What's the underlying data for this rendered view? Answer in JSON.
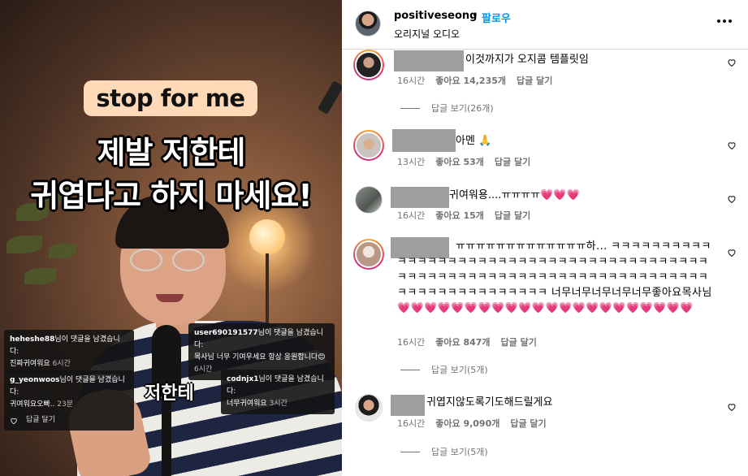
{
  "video": {
    "caption_tag": "stop for me",
    "title_line1": "제발 저한테",
    "title_line2": "귀엽다고 하지 마세요!",
    "sub_caption": "저한테",
    "notifications": [
      {
        "user": "heheshe88",
        "action": "님이 댓글을 남겼습니다:",
        "text": "진짜귀여워요",
        "time": "6시간"
      },
      {
        "user": "user690191577",
        "action": "님이 댓글을 남겼습니다:",
        "text": "목사님 너무 기여우세요 항상 응원합니다😊",
        "time": "6시간"
      },
      {
        "user": "g_yeonwoos",
        "action": "님이 댓글을 남겼습니다:",
        "text": "귀여워요오빠..",
        "time": "23분",
        "reply": "답글 달기"
      },
      {
        "user": "codnjx1",
        "action": "님이 댓글을 남겼습니다:",
        "text": "너무귀여워요",
        "time": "3시간"
      }
    ]
  },
  "header": {
    "username": "positiveseong",
    "separator": "•",
    "follow_label": "팔로우",
    "subtitle": "오리지널 오디오"
  },
  "comments": [
    {
      "text": "이것까지가 오지콤 템플릿임",
      "time": "16시간",
      "likes": "좋아요 14,235개",
      "reply_label": "답글 달기",
      "view_replies": "답글 보기(26개)"
    },
    {
      "text": "아멘 🙏",
      "time": "13시간",
      "likes": "좋아요 53개",
      "reply_label": "답글 달기"
    },
    {
      "text": "귀여워용....ㅠㅠㅠㅠ💗💗💗",
      "time": "16시간",
      "likes": "좋아요 15개",
      "reply_label": "답글 달기"
    },
    {
      "text": "ㅠㅠㅠㅠㅠㅠㅠㅠㅠㅠㅠㅠㅠ하... ㅋㅋㅋㅋㅋㅋㅋㅋㅋㅋㅋㅋㅋㅋㅋㅋㅋㅋㅋㅋㅋㅋㅋㅋㅋㅋㅋㅋㅋㅋㅋㅋㅋㅋㅋㅋㅋㅋㅋㅋㅋㅋㅋㅋㅋㅋㅋㅋㅋㅋㅋㅋㅋㅋㅋㅋㅋㅋㅋㅋㅋㅋㅋㅋㅋㅋㅋㅋㅋㅋㅋㅋㅋㅋㅋㅋㅋㅋㅋㅋㅋㅋㅋㅋㅋㅋㅋ 너무너무너무너무너무좋아요목사님 💗💗💗💗💗💗💗💗💗💗💗💗💗💗💗💗💗💗💗💗💗💗",
      "time": "16시간",
      "likes": "좋아요 847개",
      "reply_label": "답글 달기",
      "view_replies": "답글 보기(5개)"
    },
    {
      "text": "귀엽지않도록기도해드릴게요",
      "time": "16시간",
      "likes": "좋아요 9,090개",
      "reply_label": "답글 달기",
      "view_replies": "답글 보기(5개)"
    }
  ],
  "icons": {
    "more": "more-horizontal-icon",
    "like": "heart-outline-icon",
    "reply_notification": "heart-outline-icon"
  },
  "colors": {
    "follow": "#0095f6",
    "meta_text": "#737373",
    "caption_tag_bg": "#ffd9b8",
    "emoji_heart": "#f0417f"
  }
}
